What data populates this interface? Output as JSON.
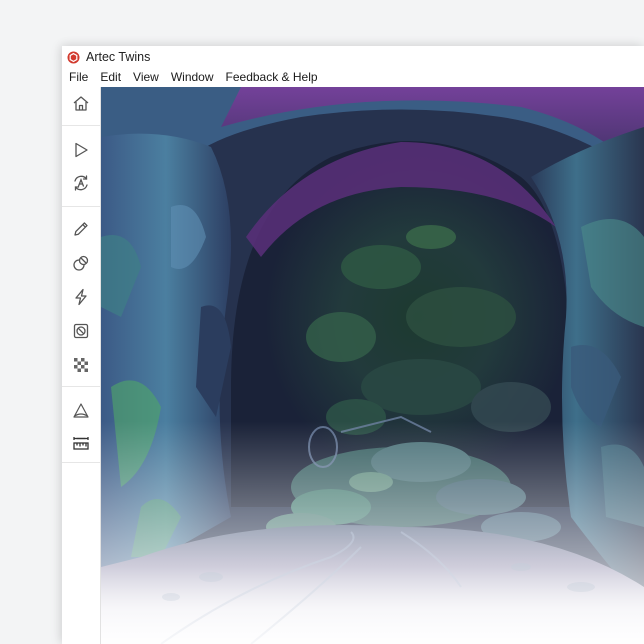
{
  "app": {
    "title": "Artec Twins",
    "logo_icon": "artec-logo-icon",
    "logo_color": "#d23a2e"
  },
  "menu": [
    {
      "label": "File"
    },
    {
      "label": "Edit"
    },
    {
      "label": "View"
    },
    {
      "label": "Window"
    },
    {
      "label": "Feedback & Help"
    }
  ],
  "toolbar": {
    "tools": [
      {
        "icon": "home-icon"
      },
      {
        "icon": "play-icon"
      },
      {
        "icon": "auto-mode-icon"
      },
      {
        "icon": "pencil-icon"
      },
      {
        "icon": "eraser-icon"
      },
      {
        "icon": "lightning-icon"
      },
      {
        "icon": "circle-slash-icon"
      },
      {
        "icon": "checkerboard-icon"
      },
      {
        "icon": "triangle-mesh-icon"
      },
      {
        "icon": "ruler-icon",
        "active": true
      }
    ]
  },
  "viewport": {
    "content": "3d-scan-tunnel",
    "palette": {
      "rock_dark": "#2b3a55",
      "rock_teal": "#3f8a8c",
      "rock_green": "#5fb06a",
      "ceiling_purple": "#6a3a8c",
      "floor_light": "#f4f3f6"
    }
  }
}
